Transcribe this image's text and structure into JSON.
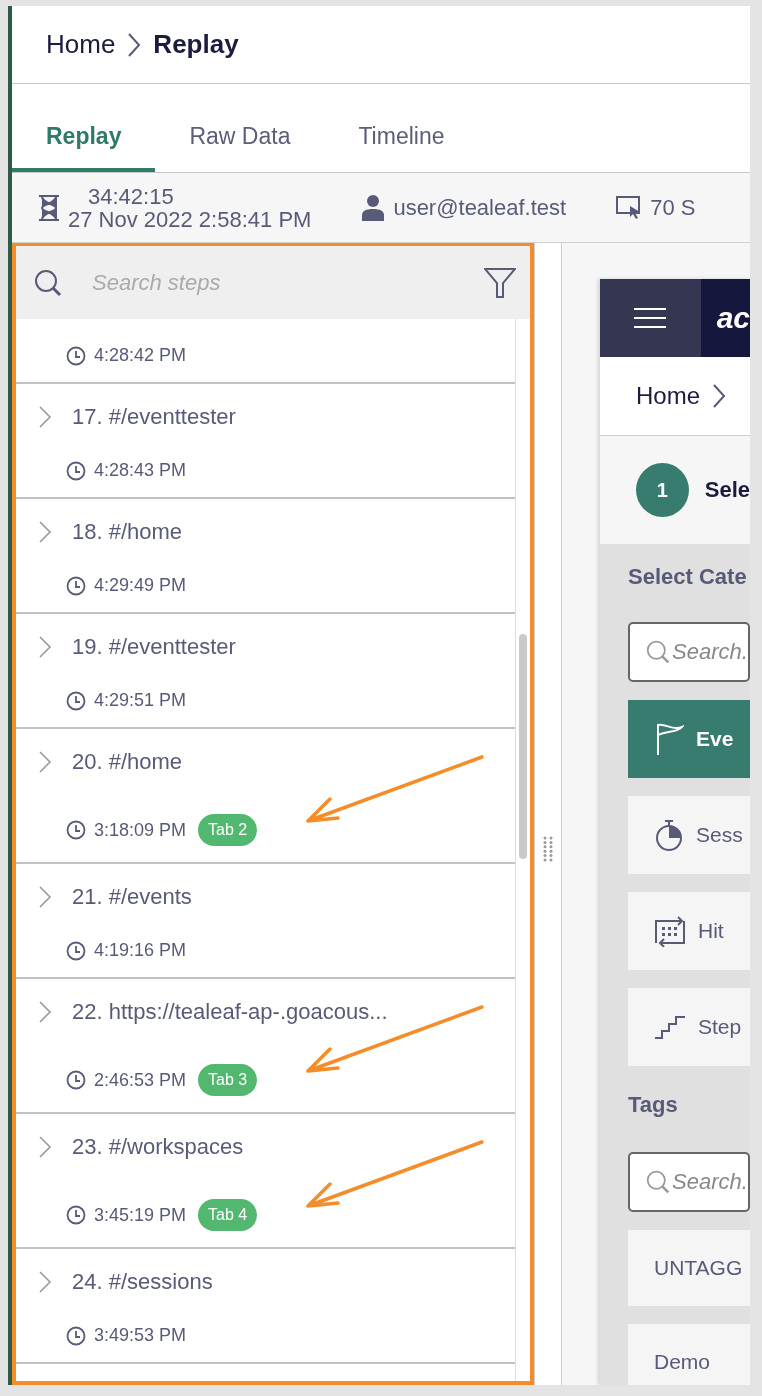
{
  "breadcrumb": {
    "items": [
      "Home",
      "Replay"
    ]
  },
  "tabs": [
    {
      "label": "Replay",
      "selected": true
    },
    {
      "label": "Raw Data",
      "selected": false
    },
    {
      "label": "Timeline",
      "selected": false
    }
  ],
  "session_info": {
    "duration": "34:42:15",
    "date": "27 Nov 2022 2:58:41 PM",
    "user": "user@tealeaf.test",
    "pages": "70 S"
  },
  "step_search": {
    "placeholder": "Search steps"
  },
  "steps": [
    {
      "time": "4:28:42 PM",
      "arrow": false
    },
    {
      "title": "17. #/eventtester",
      "time": "4:28:43 PM",
      "arrow": false
    },
    {
      "title": "18. #/home",
      "time": "4:29:49 PM",
      "arrow": false
    },
    {
      "title": "19. #/eventtester",
      "time": "4:29:51 PM",
      "arrow": false
    },
    {
      "title": "20. #/home",
      "time": "3:18:09 PM",
      "badge": "Tab 2",
      "arrow": true
    },
    {
      "title": "21. #/events",
      "time": "4:19:16 PM",
      "arrow": false
    },
    {
      "title": "22. https://tealeaf-ap-.goacous...",
      "time": "2:46:53 PM",
      "badge": "Tab 3",
      "arrow": true
    },
    {
      "title": "23. #/workspaces",
      "time": "3:45:19 PM",
      "badge": "Tab 4",
      "arrow": true
    },
    {
      "title": "24. #/sessions",
      "time": "3:49:53 PM",
      "arrow": false
    }
  ],
  "preview": {
    "brand": "ac",
    "breadcrumb": "Home",
    "step_number": "1",
    "step_label": "Sele",
    "section_title": "Select Cate",
    "category_search": {
      "placeholder": "Search."
    },
    "categories": [
      {
        "kind": "flag",
        "label": "Eve",
        "selected": true
      },
      {
        "kind": "timer",
        "label": "Sess",
        "selected": false
      },
      {
        "kind": "hits",
        "label": "Hit",
        "selected": false
      },
      {
        "kind": "stairs",
        "label": "Step",
        "selected": false
      }
    ],
    "tags_title": "Tags",
    "tag_search": {
      "placeholder": "Search."
    },
    "tags": [
      "UNTAGG",
      "Demo"
    ]
  }
}
